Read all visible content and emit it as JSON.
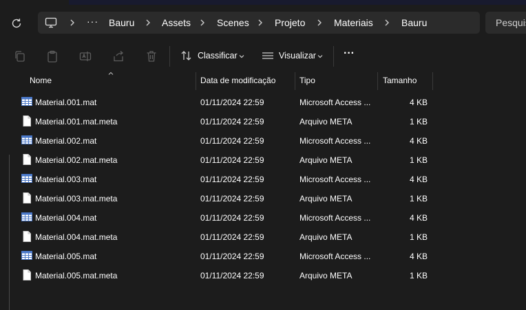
{
  "navbar": {
    "breadcrumbs": [
      "Bauru",
      "Assets",
      "Scenes",
      "Projeto",
      "Materiais",
      "Bauru"
    ],
    "more_label": "···",
    "search_placeholder": "Pesquisar"
  },
  "toolbar": {
    "sort_label": "Classificar",
    "view_label": "Visualizar",
    "more_label": "···"
  },
  "columns": {
    "name": "Nome",
    "date": "Data de modificação",
    "type": "Tipo",
    "size": "Tamanho"
  },
  "files": [
    {
      "name": "Material.001.mat",
      "date": "01/11/2024 22:59",
      "type": "Microsoft Access ...",
      "size": "4 KB",
      "icon": "table-file-icon"
    },
    {
      "name": "Material.001.mat.meta",
      "date": "01/11/2024 22:59",
      "type": "Arquivo META",
      "size": "1 KB",
      "icon": "blank-file-icon"
    },
    {
      "name": "Material.002.mat",
      "date": "01/11/2024 22:59",
      "type": "Microsoft Access ...",
      "size": "4 KB",
      "icon": "table-file-icon"
    },
    {
      "name": "Material.002.mat.meta",
      "date": "01/11/2024 22:59",
      "type": "Arquivo META",
      "size": "1 KB",
      "icon": "blank-file-icon"
    },
    {
      "name": "Material.003.mat",
      "date": "01/11/2024 22:59",
      "type": "Microsoft Access ...",
      "size": "4 KB",
      "icon": "table-file-icon"
    },
    {
      "name": "Material.003.mat.meta",
      "date": "01/11/2024 22:59",
      "type": "Arquivo META",
      "size": "1 KB",
      "icon": "blank-file-icon"
    },
    {
      "name": "Material.004.mat",
      "date": "01/11/2024 22:59",
      "type": "Microsoft Access ...",
      "size": "4 KB",
      "icon": "table-file-icon"
    },
    {
      "name": "Material.004.mat.meta",
      "date": "01/11/2024 22:59",
      "type": "Arquivo META",
      "size": "1 KB",
      "icon": "blank-file-icon"
    },
    {
      "name": "Material.005.mat",
      "date": "01/11/2024 22:59",
      "type": "Microsoft Access ...",
      "size": "4 KB",
      "icon": "table-file-icon"
    },
    {
      "name": "Material.005.mat.meta",
      "date": "01/11/2024 22:59",
      "type": "Arquivo META",
      "size": "1 KB",
      "icon": "blank-file-icon"
    }
  ],
  "colors": {
    "background": "#1c1c1c",
    "address_bar": "#2b2b2b",
    "disabled_icon": "#5d5d5d",
    "table_icon_blue": "#4a78c8"
  }
}
